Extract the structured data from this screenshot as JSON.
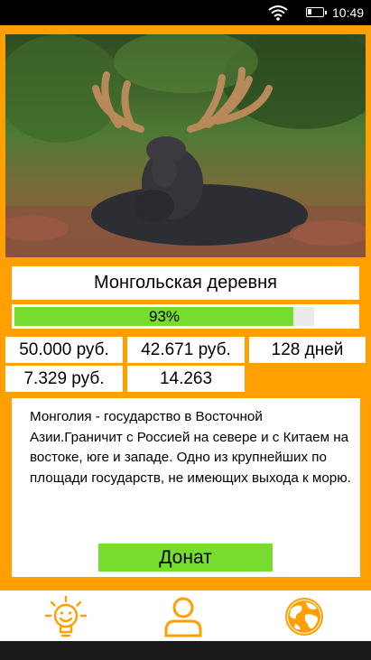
{
  "status_bar": {
    "time": "10:49"
  },
  "place": {
    "title": "Монгольская деревня",
    "progress_percent": 93,
    "progress_label": "93%"
  },
  "stats": {
    "goal": "50.000 руб.",
    "collected": "42.671 руб.",
    "days": "128 дней",
    "remaining": "7.329 руб.",
    "count": "14.263"
  },
  "description": "Монголия - государство в Восточной Азии.Граничит с Россией на севере и с Китаем на востоке, юге и западе. Одно из крупнейших по площади государств, не имеющих выхода к морю.",
  "donate_label": "Донат",
  "nav": {
    "items": [
      {
        "icon": "lightbulb-icon"
      },
      {
        "icon": "person-icon"
      },
      {
        "icon": "globe-icon"
      }
    ]
  },
  "colors": {
    "accent": "#ffa000",
    "progress": "#76dd2e",
    "button": "#76dd2e"
  }
}
